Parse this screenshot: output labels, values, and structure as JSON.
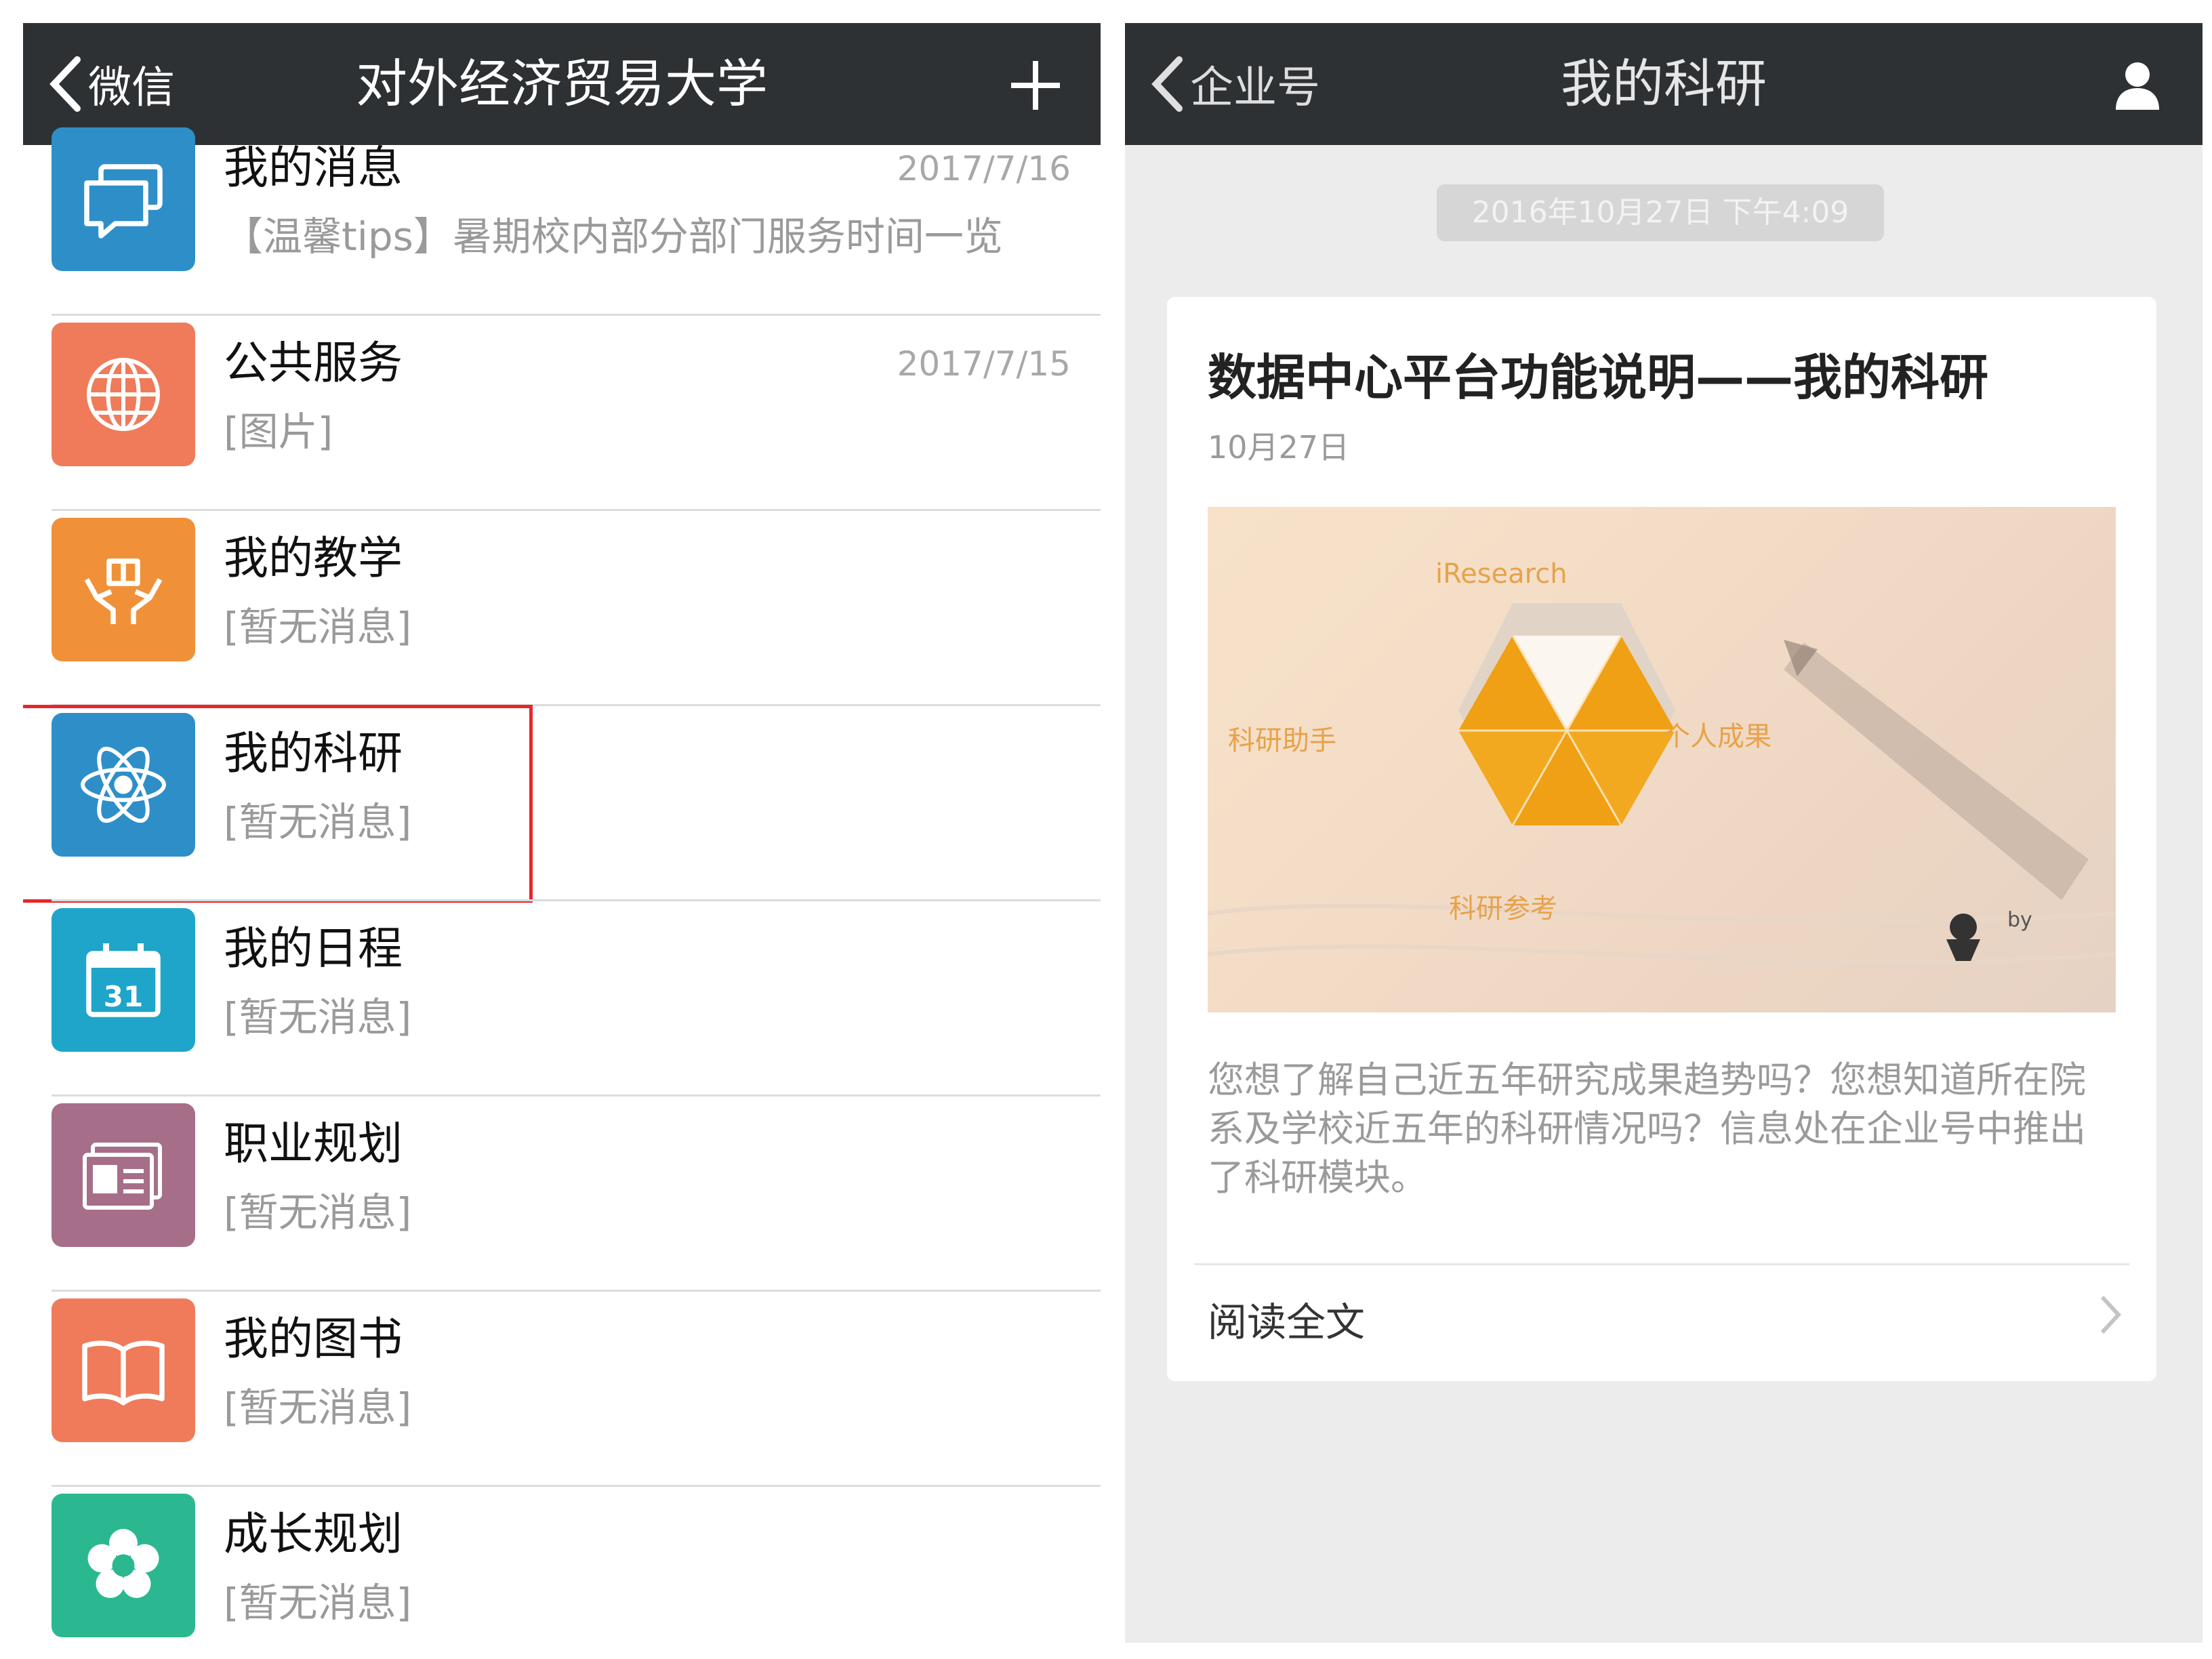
{
  "left": {
    "nav": {
      "back_label": "微信",
      "title": "对外经济贸易大学"
    },
    "items": [
      {
        "title": "我的消息",
        "subtitle": "【温馨tips】暑期校内部分部门服务时间一览",
        "date": "2017/7/16",
        "icon": "chat-bubbles-icon",
        "color": "#2e8fc8"
      },
      {
        "title": "公共服务",
        "subtitle": "[图片]",
        "date": "2017/7/15",
        "icon": "globe-icon",
        "color": "#ef7b5a"
      },
      {
        "title": "我的教学",
        "subtitle": "[暂无消息]",
        "date": "",
        "icon": "hands-book-icon",
        "color": "#f0913a"
      },
      {
        "title": "我的科研",
        "subtitle": "[暂无消息]",
        "date": "",
        "icon": "atom-icon",
        "color": "#2e8fc8"
      },
      {
        "title": "我的日程",
        "subtitle": "[暂无消息]",
        "date": "",
        "icon": "calendar-icon",
        "color": "#1ea5c9"
      },
      {
        "title": "职业规划",
        "subtitle": "[暂无消息]",
        "date": "",
        "icon": "id-card-icon",
        "color": "#a66e89"
      },
      {
        "title": "我的图书",
        "subtitle": "[暂无消息]",
        "date": "",
        "icon": "open-book-icon",
        "color": "#ef7b5a"
      },
      {
        "title": "成长规划",
        "subtitle": "[暂无消息]",
        "date": "",
        "icon": "flower-icon",
        "color": "#2bb890"
      }
    ],
    "calendar_day": "31"
  },
  "right": {
    "nav": {
      "back_label": "企业号",
      "title": "我的科研"
    },
    "timestamp": "2016年10月27日 下午4:09",
    "card": {
      "title": "数据中心平台功能说明——我的科研",
      "date": "10月27日",
      "cover": {
        "brand": "iResearch",
        "left_label": "科研助手",
        "right_label": "个人成果",
        "bottom_label": "科研参考",
        "byline": "by"
      },
      "description": "您想了解自己近五年研究成果趋势吗？您想知道所在院系及学校近五年的科研情况吗？信息处在企业号中推出了科研模块。",
      "read_more": "阅读全文"
    }
  }
}
